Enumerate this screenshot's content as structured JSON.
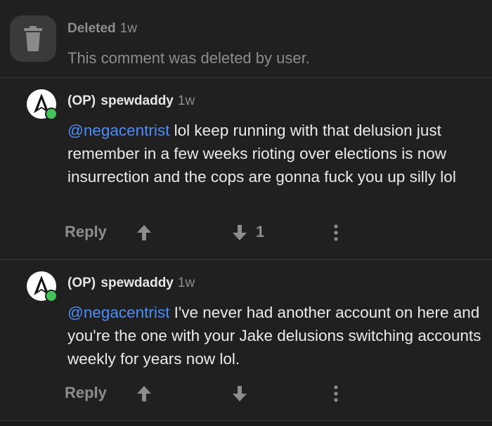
{
  "deleted_comment": {
    "name": "Deleted",
    "time": "1w",
    "message": "This comment was deleted by user."
  },
  "comments": [
    {
      "op": "(OP)",
      "username": "spewdaddy",
      "time": "1w",
      "mention": "@negacentrist",
      "text": " lol keep running with that delusion just remember in a few weeks rioting over elections is now insurrection and the cops are gonna fuck you up silly lol",
      "reply_label": "Reply",
      "vote_count": "1"
    },
    {
      "op": "(OP)",
      "username": "spewdaddy",
      "time": "1w",
      "mention": "@negacentrist",
      "text": " I've never had another account on here and you're the one with your Jake delusions switching accounts weekly for years now lol.",
      "reply_label": "Reply",
      "vote_count": ""
    }
  ],
  "colors": {
    "background": "#202020",
    "mention": "#4b8ef7",
    "muted": "#8d8d8d",
    "online_dot": "#45c35a"
  },
  "icons": [
    "trash-icon",
    "upvote-arrow-icon",
    "downvote-arrow-icon",
    "more-vertical-icon",
    "avatar-logo-icon"
  ]
}
